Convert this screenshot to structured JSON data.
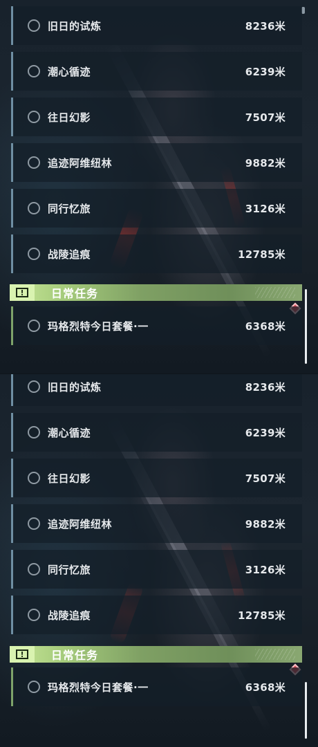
{
  "quests": [
    {
      "name": "旧日的试炼",
      "distance": "8236米"
    },
    {
      "name": "潮心循迹",
      "distance": "6239米"
    },
    {
      "name": "往日幻影",
      "distance": "7507米"
    },
    {
      "name": "追迹阿维纽林",
      "distance": "9882米"
    },
    {
      "name": "同行忆旅",
      "distance": "3126米"
    },
    {
      "name": "战陵追痕",
      "distance": "12785米"
    }
  ],
  "daily_section": {
    "title": "日常任务",
    "badge_icon": "exclamation-icon",
    "badge_glyph": "!",
    "quest": {
      "name": "玛格烈特今日套餐·一",
      "distance": "6368米"
    }
  },
  "colors": {
    "accent_daily": "#a6cc7c",
    "accent_quest": "#6f8fa3",
    "alert": "#d84a55"
  }
}
